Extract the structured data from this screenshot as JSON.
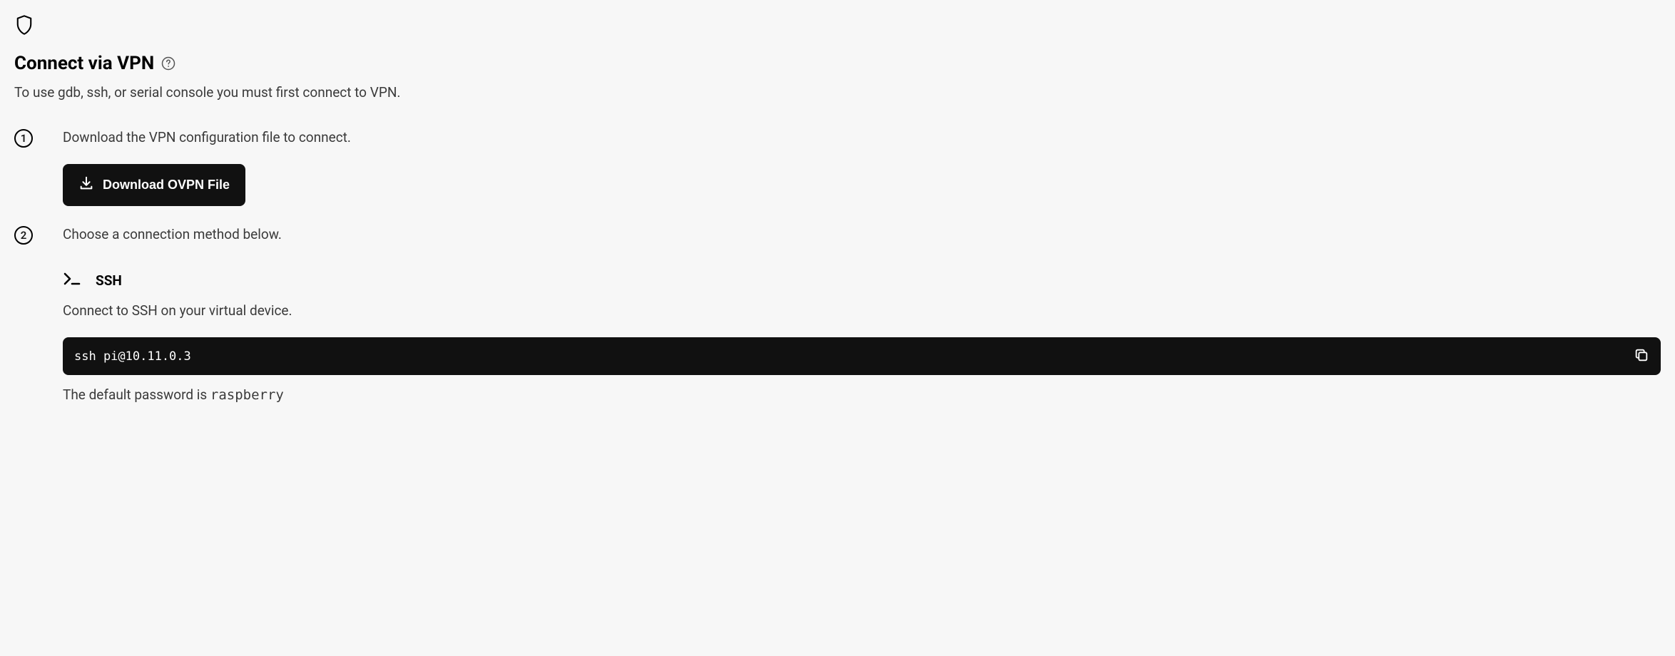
{
  "heading": "Connect via VPN",
  "subtext": "To use gdb, ssh, or serial console you must first connect to VPN.",
  "steps": {
    "one": {
      "number": "1",
      "text": "Download the VPN configuration file to connect.",
      "button_label": "Download OVPN File"
    },
    "two": {
      "number": "2",
      "text": "Choose a connection method below."
    }
  },
  "ssh": {
    "title": "SSH",
    "description": "Connect to SSH on your virtual device.",
    "command": "ssh pi@10.11.0.3",
    "password_note_prefix": "The default password is ",
    "password_value": "raspberry"
  }
}
